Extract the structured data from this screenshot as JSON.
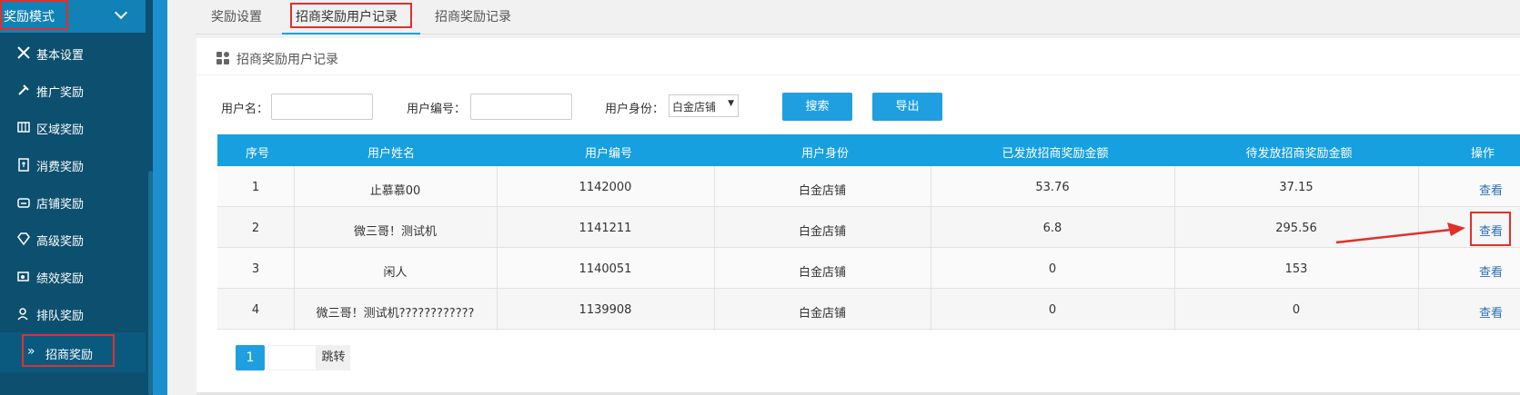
{
  "sidebar": {
    "header_title": "奖励模式",
    "items": [
      {
        "label": "基本设置",
        "icon": "tools-icon"
      },
      {
        "label": "推广奖励",
        "icon": "hammer-icon"
      },
      {
        "label": "区域奖励",
        "icon": "map-icon"
      },
      {
        "label": "消费奖励",
        "icon": "clipboard-icon"
      },
      {
        "label": "店铺奖励",
        "icon": "shop-icon"
      },
      {
        "label": "高级奖励",
        "icon": "diamond-icon"
      },
      {
        "label": "绩效奖励",
        "icon": "performance-icon"
      },
      {
        "label": "排队奖励",
        "icon": "users-icon"
      },
      {
        "label": "招商奖励",
        "icon": "double-chevron-right-icon"
      }
    ]
  },
  "tabs": [
    {
      "label": "奖励设置"
    },
    {
      "label": "招商奖励用户记录"
    },
    {
      "label": "招商奖励记录"
    }
  ],
  "panel": {
    "title": "招商奖励用户记录"
  },
  "filters": {
    "username_label": "用户名：",
    "username_value": "",
    "userno_label": "用户编号：",
    "userno_value": "",
    "identity_label": "用户身份：",
    "identity_selected": "白金店铺",
    "search_button": "搜索",
    "export_button": "导出"
  },
  "table": {
    "headers": [
      "序号",
      "用户姓名",
      "用户编号",
      "用户身份",
      "已发放招商奖励金额",
      "待发放招商奖励金额",
      "操作"
    ],
    "rows": [
      {
        "seq": "1",
        "name": "止慕慕00",
        "no": "1142000",
        "identity": "白金店铺",
        "issued": "53.76",
        "pending": "37.15",
        "action": "查看"
      },
      {
        "seq": "2",
        "name": "微三哥！测试机",
        "no": "1141211",
        "identity": "白金店铺",
        "issued": "6.8",
        "pending": "295.56",
        "action": "查看"
      },
      {
        "seq": "3",
        "name": "闲人",
        "no": "1140051",
        "identity": "白金店铺",
        "issued": "0",
        "pending": "153",
        "action": "查看"
      },
      {
        "seq": "4",
        "name": "微三哥！测试机????????????",
        "no": "1139908",
        "identity": "白金店铺",
        "issued": "0",
        "pending": "0",
        "action": "查看"
      }
    ]
  },
  "pagination": {
    "current_page": "1",
    "jump_label": "跳转"
  },
  "colors": {
    "sidebar_bg": "#0d4f6e",
    "accent": "#1f9fe0",
    "annotation_red": "#e0302c"
  }
}
